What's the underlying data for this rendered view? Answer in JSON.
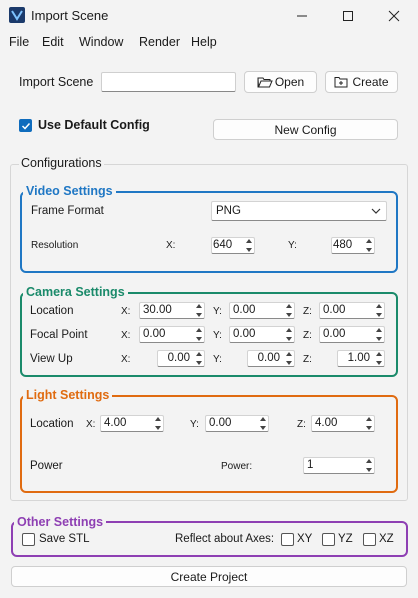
{
  "window": {
    "title": "Import Scene",
    "icon": "app-icon"
  },
  "menu": [
    "File",
    "Edit",
    "Window",
    "Render",
    "Help"
  ],
  "import": {
    "label": "Import Scene",
    "value": "",
    "open_label": "Open",
    "create_label": "Create"
  },
  "config": {
    "use_default_label": "Use Default Config",
    "use_default_checked": true,
    "new_config_label": "New Config"
  },
  "configurations_label": "Configurations",
  "video": {
    "title": "Video Settings",
    "frame_format_label": "Frame Format",
    "frame_format_value": "PNG",
    "resolution_label": "Resolution",
    "x_label": "X:",
    "x_value": "640",
    "y_label": "Y:",
    "y_value": "480"
  },
  "camera": {
    "title": "Camera Settings",
    "rows": [
      {
        "label": "Location",
        "x": "30.00",
        "y": "0.00",
        "z": "0.00"
      },
      {
        "label": "Focal Point",
        "x": "0.00",
        "y": "0.00",
        "z": "0.00"
      },
      {
        "label": "View Up",
        "x": "0.00",
        "y": "0.00",
        "z": "1.00"
      }
    ],
    "x_label": "X:",
    "y_label": "Y:",
    "z_label": "Z:"
  },
  "light": {
    "title": "Light Settings",
    "location_label": "Location",
    "x_label": "X:",
    "x_value": "4.00",
    "y_label": "Y:",
    "y_value": "0.00",
    "z_label": "Z:",
    "z_value": "4.00",
    "power_label": "Power",
    "power_inline_label": "Power:",
    "power_value": "1"
  },
  "other": {
    "title": "Other Settings",
    "save_stl_label": "Save STL",
    "reflect_label": "Reflect about Axes:",
    "axes": [
      "XY",
      "YZ",
      "XZ"
    ]
  },
  "create_project_label": "Create Project",
  "colors": {
    "video": "#1f77c4",
    "camera": "#1a8a6a",
    "light": "#e06b10",
    "other": "#8e3fb3",
    "accent": "#0f6cbd"
  }
}
